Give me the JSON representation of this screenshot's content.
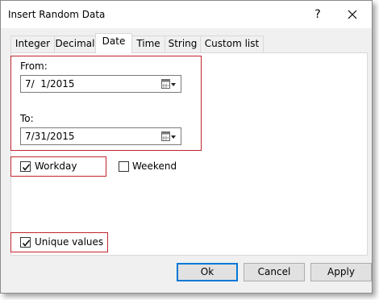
{
  "window": {
    "title": "Insert Random Data",
    "help_glyph": "?",
    "close_icon": "close-icon"
  },
  "tabs": [
    {
      "label": "Integer"
    },
    {
      "label": "Decimal"
    },
    {
      "label": "Date",
      "active": true
    },
    {
      "label": "Time"
    },
    {
      "label": "String"
    },
    {
      "label": "Custom list"
    }
  ],
  "date_tab": {
    "from_label": "From:",
    "from_value": "7/  1/2015",
    "to_label": "To:",
    "to_value": "7/31/2015",
    "workday": {
      "label": "Workday",
      "checked": true
    },
    "weekend": {
      "label": "Weekend",
      "checked": false
    },
    "unique": {
      "label": "Unique values",
      "checked": true
    }
  },
  "buttons": {
    "ok": "Ok",
    "cancel": "Cancel",
    "apply": "Apply"
  },
  "colors": {
    "highlight_border": "#c0252c",
    "accent": "#0078d7"
  }
}
